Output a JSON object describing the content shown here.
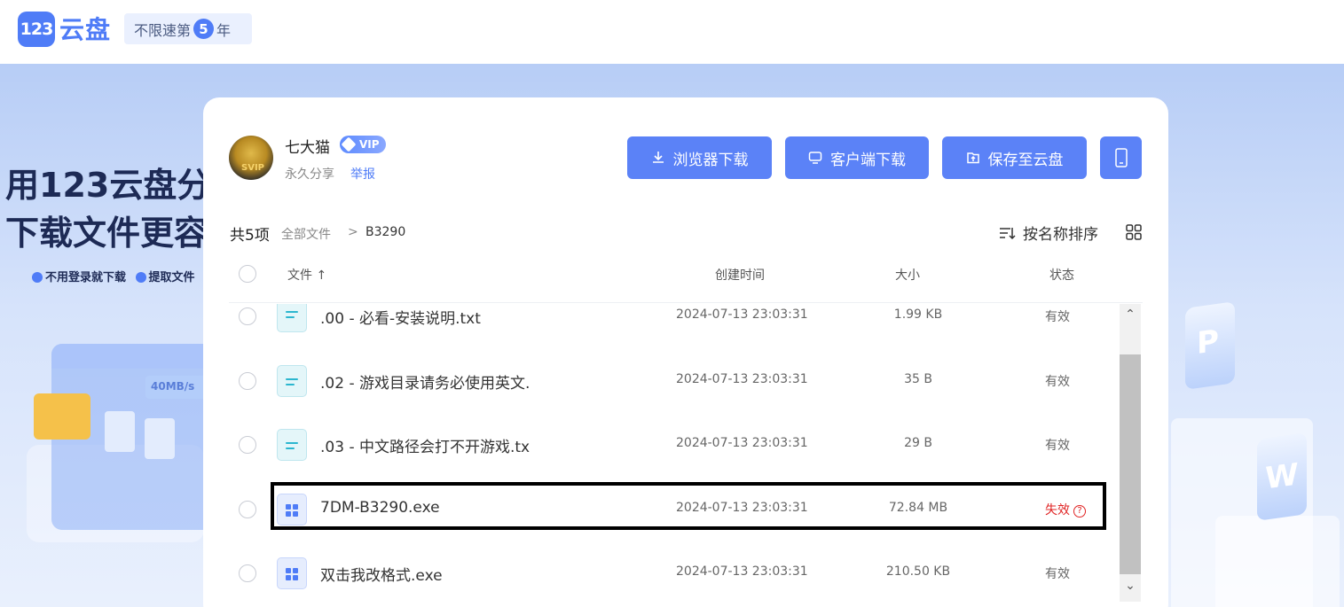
{
  "header": {
    "logo_badge": "123",
    "logo_text": "云盘",
    "promo_prefix": "不限速第",
    "promo_num": "5",
    "promo_suffix": "年"
  },
  "hero": {
    "line1": "用123云盘分",
    "line2": "下载文件更容",
    "feature1": "不用登录就下载",
    "feature2": "提取文件",
    "speed_tag": "40MB/s"
  },
  "owner": {
    "name": "七大猫",
    "vip_label": "VIP",
    "avatar_label": "SVIP",
    "share_type": "永久分享",
    "report": "举报"
  },
  "actions": {
    "browser_download": "浏览器下载",
    "client_download": "客户端下载",
    "save_to_cloud": "保存至云盘"
  },
  "toolbar": {
    "count": "共5项",
    "breadcrumb_all": "全部文件",
    "breadcrumb_sep": ">",
    "breadcrumb_current": "B3290",
    "sort_label": "按名称排序"
  },
  "table": {
    "col_file": "文件 ↑",
    "col_time": "创建时间",
    "col_size": "大小",
    "col_status": "状态",
    "rows": [
      {
        "name": ".00 - 必看-安装说明.txt",
        "time": "2024-07-13 23:03:31",
        "size": "1.99 KB",
        "status": "有效"
      },
      {
        "name": ".02 - 游戏目录请务必使用英文.",
        "time": "2024-07-13 23:03:31",
        "size": "35 B",
        "status": "有效"
      },
      {
        "name": ".03 - 中文路径会打不开游戏.tx",
        "time": "2024-07-13 23:03:31",
        "size": "29 B",
        "status": "有效"
      },
      {
        "name": "7DM-B3290.exe",
        "time": "2024-07-13 23:03:31",
        "size": "72.84 MB",
        "status": "失效"
      },
      {
        "name": "双击我改格式.exe",
        "time": "2024-07-13 23:03:31",
        "size": "210.50 KB",
        "status": "有效"
      }
    ]
  },
  "scroll": {
    "up": "⌃",
    "down": "⌄"
  },
  "colors": {
    "accent": "#5b82f7",
    "invalid": "#e02424",
    "highlight_border": "#000000"
  }
}
